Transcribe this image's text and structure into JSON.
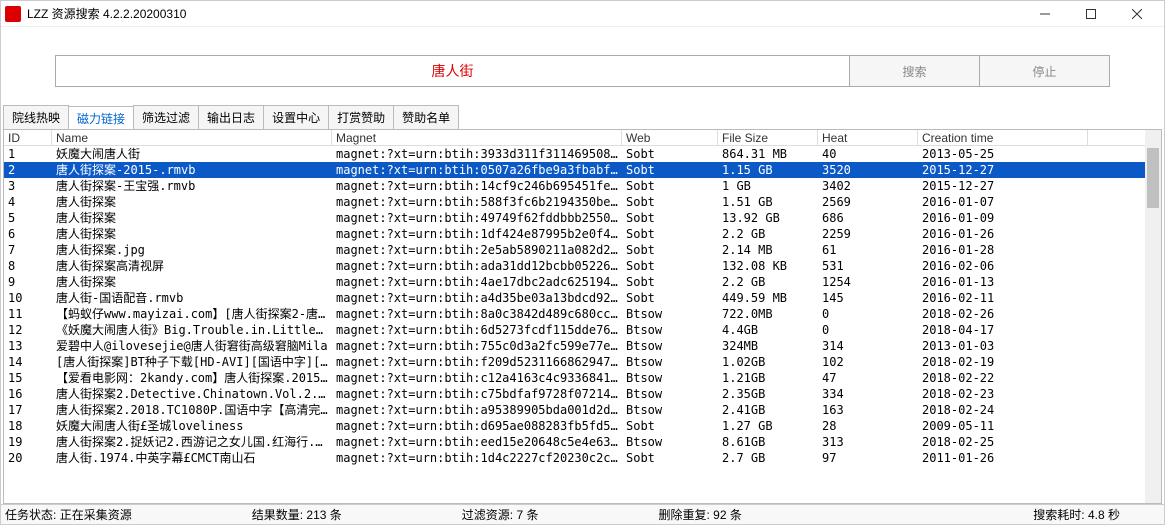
{
  "window": {
    "title": "LZZ 资源搜索 4.2.2.20200310"
  },
  "search": {
    "value": "唐人街",
    "placeholder": "",
    "search_label": "搜索",
    "stop_label": "停止"
  },
  "tabs": [
    "院线热映",
    "磁力链接",
    "筛选过滤",
    "输出日志",
    "设置中心",
    "打赏赞助",
    "赞助名单"
  ],
  "columns": {
    "id": "ID",
    "name": "Name",
    "magnet": "Magnet",
    "web": "Web",
    "size": "File Size",
    "heat": "Heat",
    "time": "Creation time"
  },
  "rows": [
    {
      "id": "1",
      "name": "妖魔大闹唐人街",
      "magnet": "magnet:?xt=urn:btih:3933d311f311469508762...",
      "web": "Sobt",
      "size": "864.31 MB",
      "heat": "40",
      "time": "2013-05-25"
    },
    {
      "id": "2",
      "name": "唐人街探案-2015-.rmvb",
      "magnet": "magnet:?xt=urn:btih:0507a26fbe9a3fbabfc5a...",
      "web": "Sobt",
      "size": "1.15 GB",
      "heat": "3520",
      "time": "2015-12-27",
      "selected": true
    },
    {
      "id": "3",
      "name": "唐人街探案-王宝强.rmvb",
      "magnet": "magnet:?xt=urn:btih:14cf9c246b695451fef7c...",
      "web": "Sobt",
      "size": "1 GB",
      "heat": "3402",
      "time": "2015-12-27"
    },
    {
      "id": "4",
      "name": "唐人街探案",
      "magnet": "magnet:?xt=urn:btih:588f3fc6b2194350be923...",
      "web": "Sobt",
      "size": "1.51 GB",
      "heat": "2569",
      "time": "2016-01-07"
    },
    {
      "id": "5",
      "name": "唐人街探案",
      "magnet": "magnet:?xt=urn:btih:49749f62fddbbb25500c8...",
      "web": "Sobt",
      "size": "13.92 GB",
      "heat": "686",
      "time": "2016-01-09"
    },
    {
      "id": "6",
      "name": "唐人街探案",
      "magnet": "magnet:?xt=urn:btih:1df424e87995b2e0f4548...",
      "web": "Sobt",
      "size": "2.2 GB",
      "heat": "2259",
      "time": "2016-01-26"
    },
    {
      "id": "7",
      "name": "唐人街探案.jpg",
      "magnet": "magnet:?xt=urn:btih:2e5ab5890211a082d2b58...",
      "web": "Sobt",
      "size": "2.14 MB",
      "heat": "61",
      "time": "2016-01-28"
    },
    {
      "id": "8",
      "name": "唐人街探案高清视屏",
      "magnet": "magnet:?xt=urn:btih:ada31dd12bcbb05226a65...",
      "web": "Sobt",
      "size": "132.08 KB",
      "heat": "531",
      "time": "2016-02-06"
    },
    {
      "id": "9",
      "name": "唐人街探案",
      "magnet": "magnet:?xt=urn:btih:4ae17dbc2adc625194347...",
      "web": "Sobt",
      "size": "2.2 GB",
      "heat": "1254",
      "time": "2016-01-13"
    },
    {
      "id": "10",
      "name": "唐人街-国语配音.rmvb",
      "magnet": "magnet:?xt=urn:btih:a4d35be03a13bdcd92965...",
      "web": "Sobt",
      "size": "449.59 MB",
      "heat": "145",
      "time": "2016-02-11"
    },
    {
      "id": "11",
      "name": "【蚂蚁仔www.mayizai.com】[唐人街探案2-唐...",
      "magnet": "magnet:?xt=urn:btih:8a0c3842d489c680cc0ce...",
      "web": "Btsow",
      "size": "722.0MB",
      "heat": "0",
      "time": "2018-02-26"
    },
    {
      "id": "12",
      "name": "《妖魔大闹唐人街》Big.Trouble.in.Little.C...",
      "magnet": "magnet:?xt=urn:btih:6d5273fcdf115dde76d2f...",
      "web": "Btsow",
      "size": "4.4GB",
      "heat": "0",
      "time": "2018-04-17"
    },
    {
      "id": "13",
      "name": "爱碧中人@ilovesejie@唐人街窘街高级窘脑Mila",
      "magnet": "magnet:?xt=urn:btih:755c0d3a2fc599e77e1a1c...",
      "web": "Btsow",
      "size": "324MB",
      "heat": "314",
      "time": "2013-01-03"
    },
    {
      "id": "14",
      "name": "[唐人街探案]BT种子下载[HD-AVI][国语中字][...",
      "magnet": "magnet:?xt=urn:btih:f209d52311668629479...",
      "web": "Btsow",
      "size": "1.02GB",
      "heat": "102",
      "time": "2018-02-19"
    },
    {
      "id": "15",
      "name": "【爱看电影网：2kandy.com】唐人街探案.2015...",
      "magnet": "magnet:?xt=urn:btih:c12a4163c4c9336841d8aa...",
      "web": "Btsow",
      "size": "1.21GB",
      "heat": "47",
      "time": "2018-02-22"
    },
    {
      "id": "16",
      "name": "唐人街探案2.Detective.Chinatown.Vol.2.201...",
      "magnet": "magnet:?xt=urn:btih:c75bdfaf9728f07214dc8...",
      "web": "Btsow",
      "size": "2.35GB",
      "heat": "334",
      "time": "2018-02-23"
    },
    {
      "id": "17",
      "name": "唐人街探案2.2018.TC1080P.国语中字【高清完...",
      "magnet": "magnet:?xt=urn:btih:a95389905bda001d2dc68...",
      "web": "Btsow",
      "size": "2.41GB",
      "heat": "163",
      "time": "2018-02-24"
    },
    {
      "id": "18",
      "name": "妖魔大闹唐人街£圣城loveliness",
      "magnet": "magnet:?xt=urn:btih:d695ae088283fb5fd5955...",
      "web": "Sobt",
      "size": "1.27 GB",
      "heat": "28",
      "time": "2009-05-11"
    },
    {
      "id": "19",
      "name": "唐人街探案2.捉妖记2.西游记之女儿国.红海行...",
      "magnet": "magnet:?xt=urn:btih:eed15e20648c5e4e6353...",
      "web": "Btsow",
      "size": "8.61GB",
      "heat": "313",
      "time": "2018-02-25"
    },
    {
      "id": "20",
      "name": "唐人街.1974.中英字幕£CMCT南山石",
      "magnet": "magnet:?xt=urn:btih:1d4c2227cf20230c2c3d6...",
      "web": "Sobt",
      "size": "2.7 GB",
      "heat": "97",
      "time": "2011-01-26"
    }
  ],
  "status": {
    "task_label": "任务状态:",
    "task_value": "正在采集资源",
    "count_label": "结果数量:",
    "count_value": "213 条",
    "filter_label": "过滤资源:",
    "filter_value": "7 条",
    "dup_label": "删除重复:",
    "dup_value": "92 条",
    "time_label": "搜索耗时:",
    "time_value": "4.8 秒"
  }
}
